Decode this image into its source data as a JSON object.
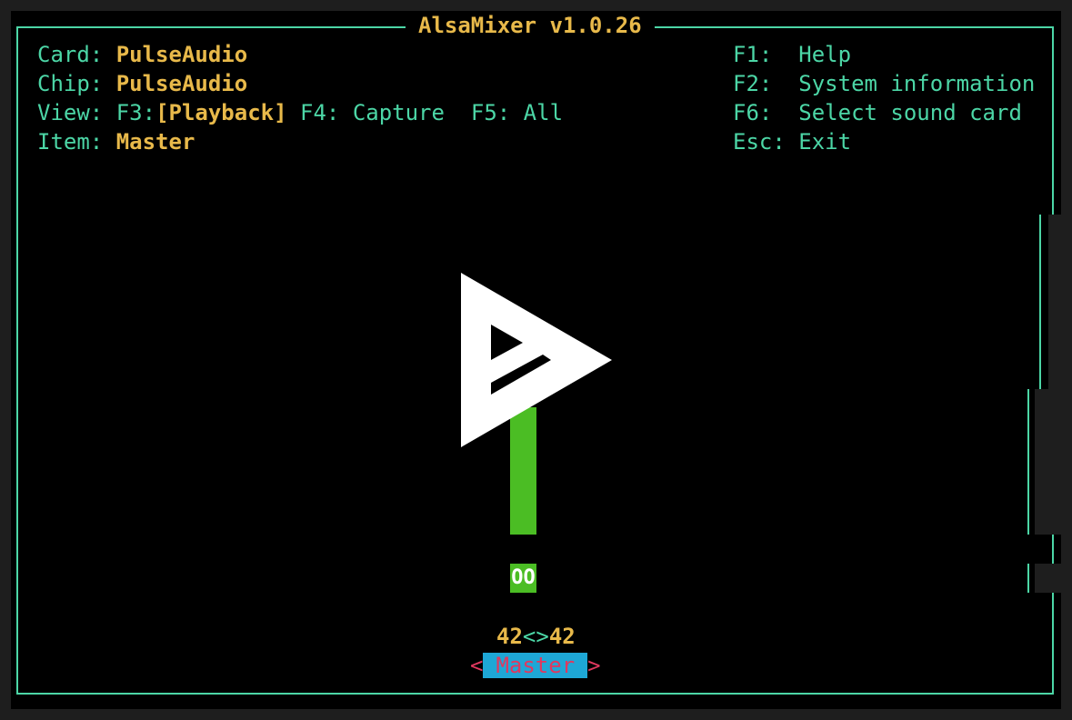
{
  "window": {
    "title": "AlsaMixer v1.0.26"
  },
  "info": {
    "card_label": "Card:",
    "card_value": "PulseAudio",
    "chip_label": "Chip:",
    "chip_value": "PulseAudio",
    "view_label": "View:",
    "view_f3": "F3:",
    "view_playback": "[Playback]",
    "view_f4": "F4: Capture",
    "view_f5": "F5: All",
    "item_label": "Item:",
    "item_value": "Master"
  },
  "shortcuts": [
    {
      "key": "F1:",
      "action": "Help"
    },
    {
      "key": "F2:",
      "action": "System information"
    },
    {
      "key": "F6:",
      "action": "Select sound card"
    },
    {
      "key": "Esc:",
      "action": "Exit"
    }
  ],
  "control": {
    "name": "Master",
    "left_arrow": "<",
    "right_arrow": ">",
    "mute_indicator": "OO",
    "level_left": "42",
    "level_sep": "<>",
    "level_right": "42",
    "volume_percent": 42
  },
  "colors": {
    "frame": "#4cd6a6",
    "value": "#e8b94a",
    "bar": "#4bbd24",
    "selected_bg": "#1ea7d6",
    "selected_fg": "#e0385f"
  },
  "icons": {
    "overlay": "play-logo-icon"
  }
}
